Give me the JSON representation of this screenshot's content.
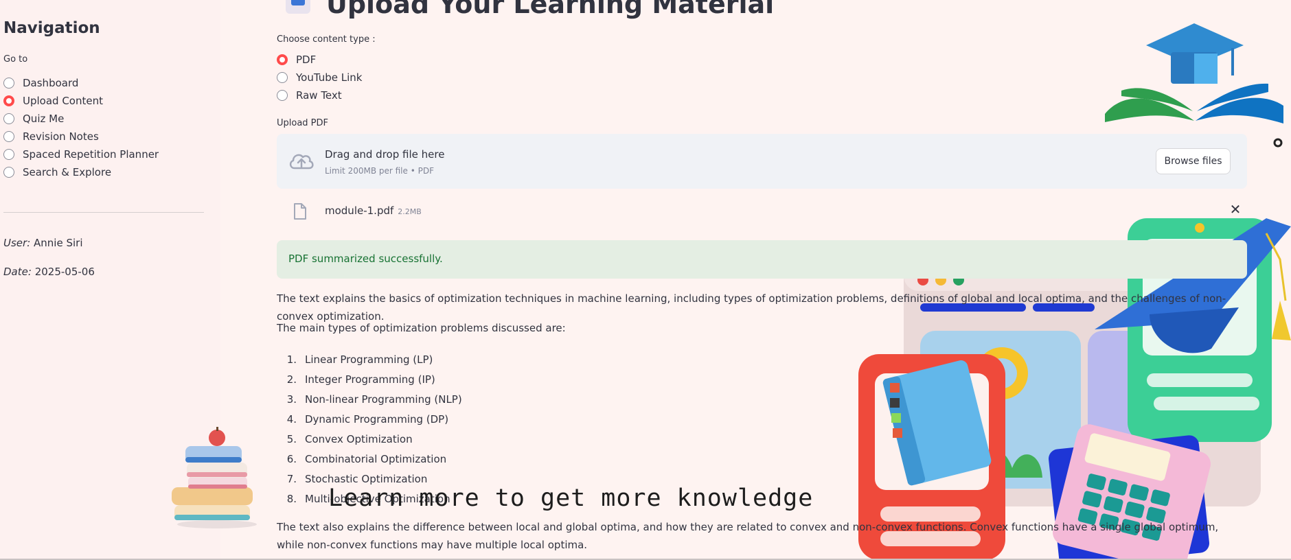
{
  "sidebar": {
    "title": "Navigation",
    "goto_label": "Go to",
    "items": [
      {
        "label": "Dashboard",
        "selected": false
      },
      {
        "label": "Upload Content",
        "selected": true
      },
      {
        "label": "Quiz Me",
        "selected": false
      },
      {
        "label": "Revision Notes",
        "selected": false
      },
      {
        "label": "Spaced Repetition Planner",
        "selected": false
      },
      {
        "label": "Search & Explore",
        "selected": false
      }
    ],
    "user_label": "User:",
    "user_value": "Annie Siri",
    "date_label": "Date:",
    "date_value": "2025-05-06"
  },
  "main": {
    "title": "Upload Your Learning Material",
    "content_type_label": "Choose content type :",
    "content_types": [
      {
        "label": "PDF",
        "selected": true
      },
      {
        "label": "YouTube Link",
        "selected": false
      },
      {
        "label": "Raw Text",
        "selected": false
      }
    ],
    "upload_label": "Upload PDF",
    "uploader": {
      "drag_text": "Drag and drop file here",
      "limit_text": "Limit 200MB per file • PDF",
      "browse_label": "Browse files"
    },
    "file": {
      "name": "module-1.pdf",
      "size": "2.2MB"
    },
    "success_message": "PDF summarized successfully.",
    "summary_intro": "The text explains the basics of optimization techniques in machine learning, including types of optimization problems, definitions of global and local optima, and the challenges of non-convex optimization.",
    "types_intro": "The main types of optimization problems discussed are:",
    "types": [
      "Linear Programming (LP)",
      "Integer Programming (IP)",
      "Non-linear Programming (NLP)",
      "Dynamic Programming (DP)",
      "Convex Optimization",
      "Combinatorial Optimization",
      "Stochastic Optimization",
      "Multi-objective Optimization"
    ],
    "summary_outro": "The text also explains the difference between local and global optima, and how they are related to convex and non-convex functions. Convex functions have a single global optimum, while non-convex functions may have multiple local optima.",
    "banner_text": "Learn more to get more knowledge"
  },
  "colors": {
    "accent": "#ff4b4b",
    "success_text": "#177233",
    "success_bg": "#e4eee3",
    "uploader_bg": "#f0f2f6"
  },
  "icons": [
    "cloud-upload-icon",
    "file-icon",
    "close-icon",
    "graduation-cap-logo",
    "books-stack-illustration",
    "learning-devices-illustration"
  ]
}
